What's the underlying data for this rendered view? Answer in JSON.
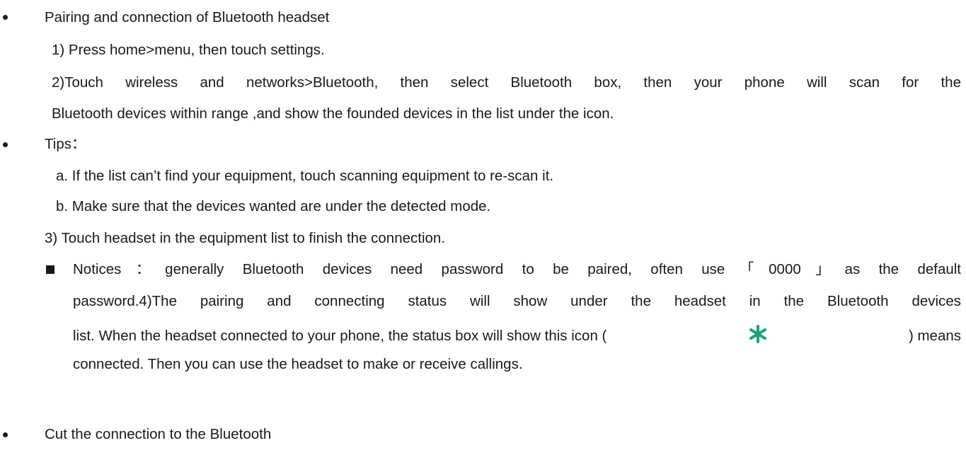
{
  "section1": {
    "heading": "Pairing and connection of Bluetooth headset",
    "step1": "1) Press home>menu, then touch settings.",
    "step2_line1": "2)Touch wireless and networks>Bluetooth, then select Bluetooth box, then your phone will scan for the",
    "step2_line2": "Bluetooth devices within range ,and show the founded devices in the list under the icon."
  },
  "tips": {
    "heading": "Tips：",
    "a": "a. If the list can’t find your equipment, touch scanning equipment to re-scan it.",
    "b": "b. Make sure that the devices wanted are under the detected mode.",
    "step3": "3) Touch headset in the equipment list to finish the connection."
  },
  "notice": {
    "line1": "Notices：generally Bluetooth devices need password to be paired, often use「0000」as the default",
    "line2": "password.4)The pairing and connecting status will show under the headset in the Bluetooth devices",
    "line3_before": "list. When the headset connected to your phone, the status box will show this icon (",
    "line3_after": ") means",
    "line4": "connected. Then you can use the headset to make or receive callings."
  },
  "section2": {
    "heading": "Cut the connection to the Bluetooth"
  },
  "icons": {
    "bullet": "bullet-dot",
    "notice_marker": "black-square",
    "bluetooth": "bluetooth-icon"
  },
  "colors": {
    "bluetooth_icon": "#1aa37a",
    "text": "#1a1a1a"
  }
}
